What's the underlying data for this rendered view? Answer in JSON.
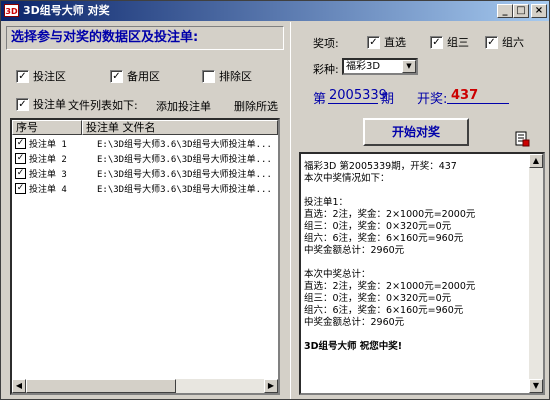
{
  "window": {
    "title": "3D组号大师 对奖",
    "icon_text": "3D"
  },
  "title_buttons": {
    "minimize": "_",
    "maximize": "□",
    "close": "×"
  },
  "left": {
    "banner": "选择参与对奖的数据区及投注单:",
    "checks": [
      {
        "label": "投注区",
        "checked": true
      },
      {
        "label": "备用区",
        "checked": true
      },
      {
        "label": "排除区",
        "checked": false
      }
    ],
    "ticket_check": {
      "label": "投注单",
      "checked": true
    },
    "file_list_label": "文件列表如下:",
    "add_ticket": "添加投注单",
    "delete_selected": "删除所选",
    "list": {
      "columns": [
        "序号",
        "投注单 文件名"
      ],
      "rows": [
        {
          "no": "投注单 1",
          "file": "E:\\3D组号大师3.6\\3D组号大师投注单...",
          "checked": true
        },
        {
          "no": "投注单 2",
          "file": "E:\\3D组号大师3.6\\3D组号大师投注单...",
          "checked": true
        },
        {
          "no": "投注单 3",
          "file": "E:\\3D组号大师3.6\\3D组号大师投注单...",
          "checked": true
        },
        {
          "no": "投注单 4",
          "file": "E:\\3D组号大师3.6\\3D组号大师投注单...",
          "checked": true
        }
      ]
    }
  },
  "right": {
    "award_label": "奖项:",
    "awards": [
      {
        "label": "直选",
        "checked": true
      },
      {
        "label": "组三",
        "checked": true
      },
      {
        "label": "组六",
        "checked": true
      }
    ],
    "lottery_label": "彩种:",
    "lottery_value": "福彩3D",
    "issue_prefix": "第",
    "issue_no": "2005339",
    "issue_suffix": "期",
    "draw_label": "开奖:",
    "draw_no": "437",
    "start_button": "开始对奖",
    "result_lines": [
      "  福彩3D 第2005339期，开奖：437",
      "    本次中奖情况如下：",
      "",
      "投注单1：",
      "    直选：2注，奖金：2×1000元=2000元",
      "    组三：0注，奖金：0×320元=0元",
      "    组六：6注，奖金：6×160元=960元",
      "    中奖金额总计：2960元",
      "",
      "本次中奖总计：",
      "    直选：2注，奖金：2×1000元=2000元",
      "    组三：0注，奖金：0×320元=0元",
      "    组六：6注，奖金：6×160元=960元",
      "    中奖金额总计：2960元",
      "",
      "    3D组号大师  祝您中奖!"
    ]
  },
  "colors": {
    "accent": "#0000aa",
    "draw_red": "#cc0000",
    "face": "#d4d0c8"
  }
}
